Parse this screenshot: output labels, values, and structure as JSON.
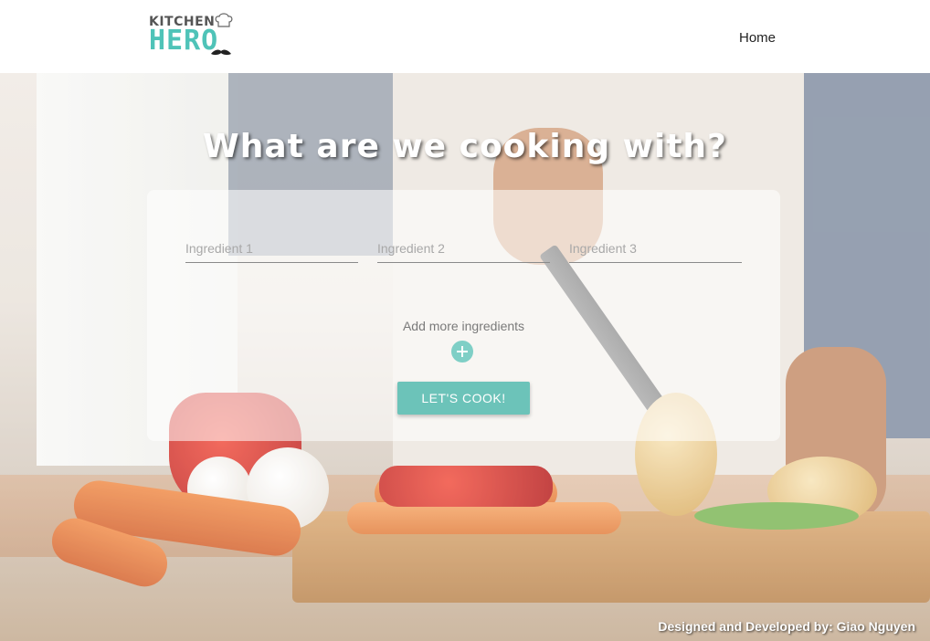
{
  "header": {
    "logo_top": "KITCHEN",
    "logo_bottom": "HERO",
    "nav_home": "Home"
  },
  "hero": {
    "title": "What are we cooking with?",
    "ingredients": [
      {
        "placeholder": "Ingredient 1",
        "value": ""
      },
      {
        "placeholder": "Ingredient 2",
        "value": ""
      },
      {
        "placeholder": "Ingredient 3",
        "value": ""
      }
    ],
    "add_more_label": "Add more ingredients",
    "add_icon": "plus-circle-icon",
    "cook_button": "LET'S COOK!"
  },
  "footer": {
    "credit": "Designed and Developed by: Giao Nguyen"
  },
  "colors": {
    "brand_teal": "#4fc3b8",
    "button_teal": "#6cc3b9"
  }
}
